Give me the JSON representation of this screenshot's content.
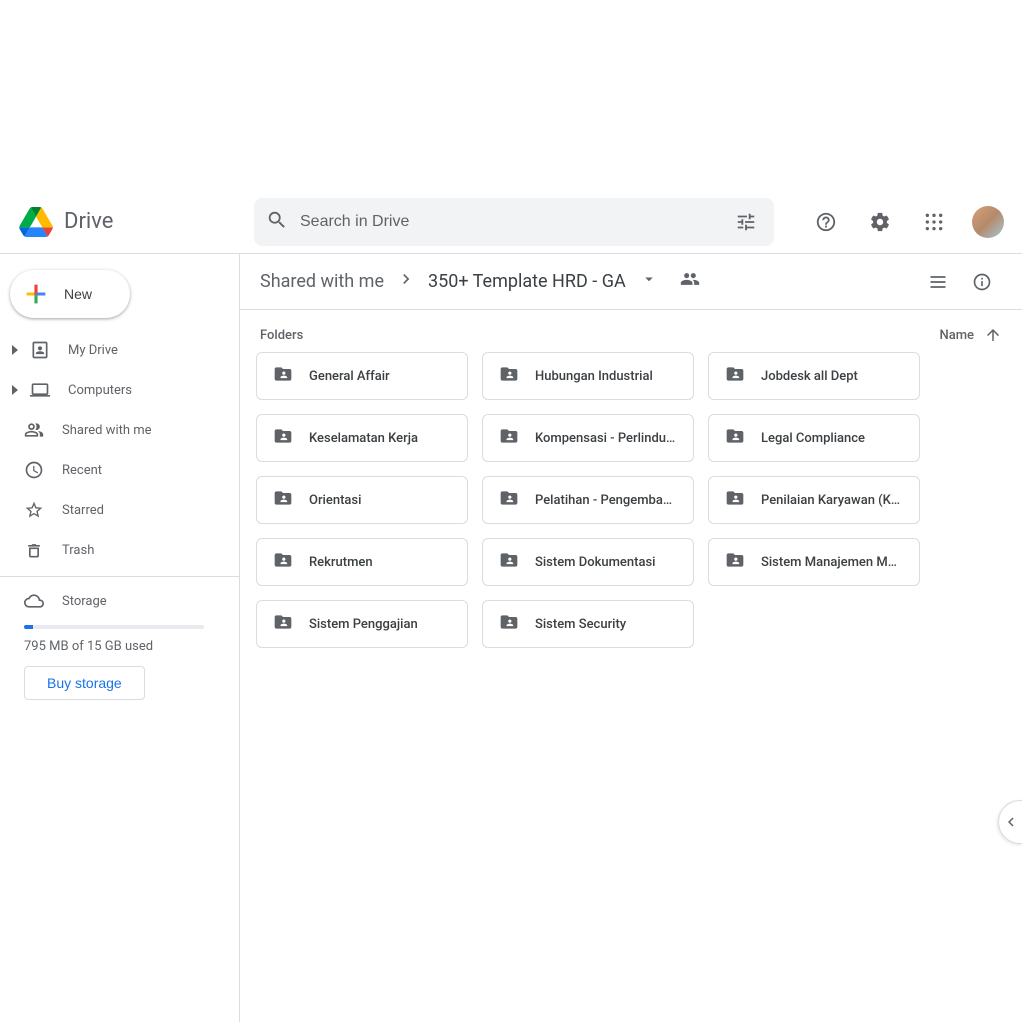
{
  "product": "Drive",
  "search": {
    "placeholder": "Search in Drive"
  },
  "newBtn": "New",
  "nav": {
    "myDrive": "My Drive",
    "computers": "Computers",
    "shared": "Shared with me",
    "recent": "Recent",
    "starred": "Starred",
    "trash": "Trash"
  },
  "storage": {
    "label": "Storage",
    "text": "795 MB of 15 GB used",
    "buy": "Buy storage"
  },
  "breadcrumb": {
    "root": "Shared with me",
    "current": "350+ Template HRD - GA"
  },
  "section": {
    "folders": "Folders",
    "sortLabel": "Name"
  },
  "folders": [
    {
      "name": "General Affair"
    },
    {
      "name": "Hubungan Industrial"
    },
    {
      "name": "Jobdesk all Dept"
    },
    {
      "name": "Keselamatan Kerja"
    },
    {
      "name": "Kompensasi - Perlindu…"
    },
    {
      "name": "Legal Compliance"
    },
    {
      "name": "Orientasi"
    },
    {
      "name": "Pelatihan - Pengemban…"
    },
    {
      "name": "Penilaian Karyawan (K…"
    },
    {
      "name": "Rekrutmen"
    },
    {
      "name": "Sistem Dokumentasi"
    },
    {
      "name": "Sistem Manajemen Mu…"
    },
    {
      "name": "Sistem Penggajian"
    },
    {
      "name": "Sistem Security"
    }
  ]
}
